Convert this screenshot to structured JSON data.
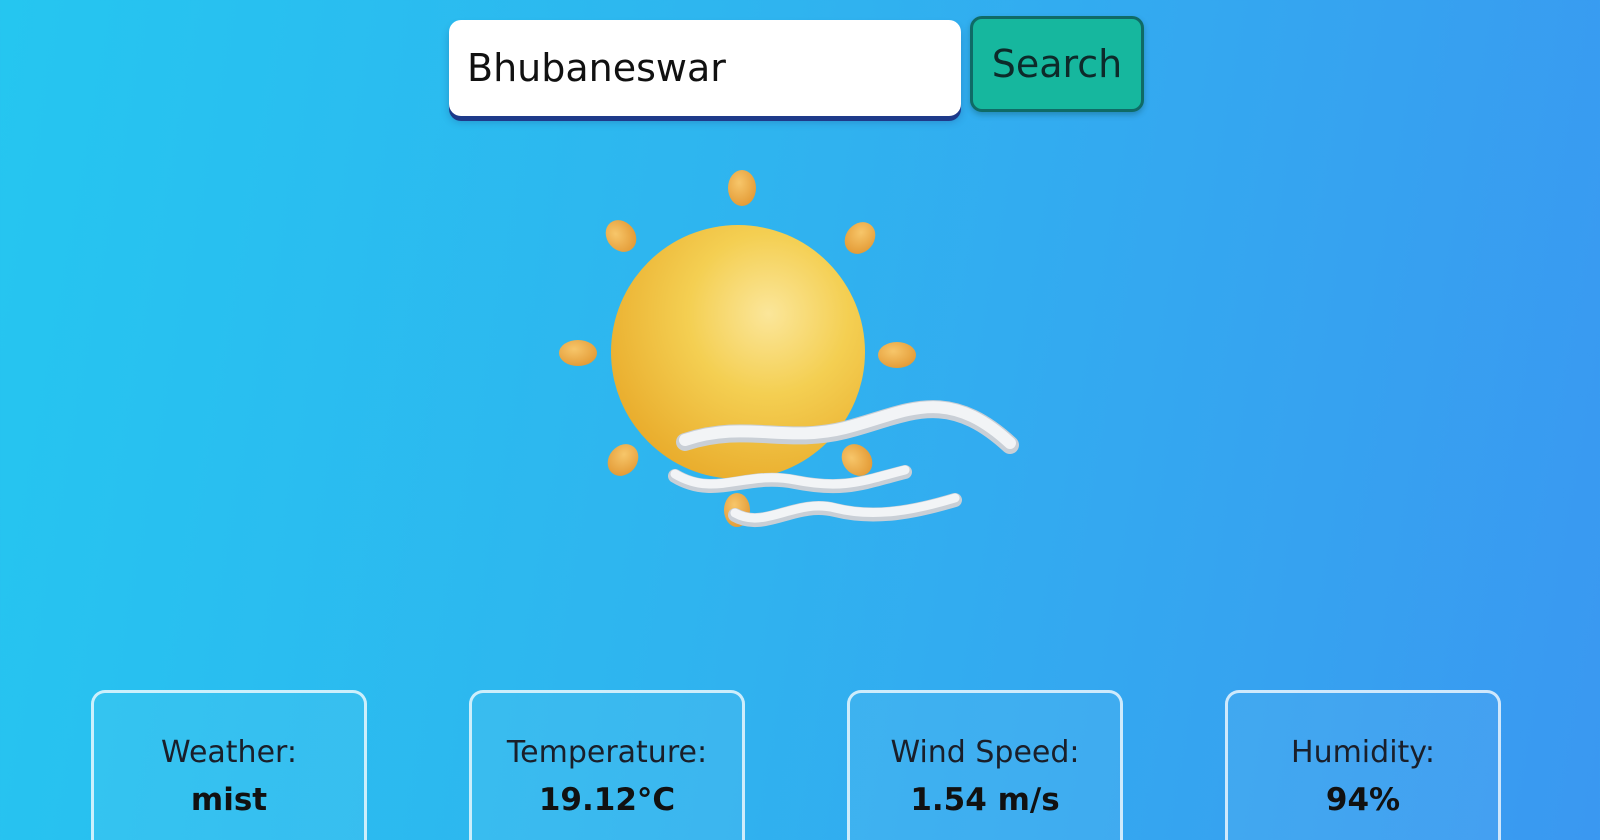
{
  "search": {
    "value": "Bhubaneswar",
    "button_label": "Search"
  },
  "weather_icon": {
    "name": "sun-with-wind-icon",
    "sun_color": "#f2c744",
    "ray_color": "#eba53f",
    "wind_color": "#e8ecef"
  },
  "cards": [
    {
      "label": "Weather:",
      "value": "mist"
    },
    {
      "label": "Temperature:",
      "value": "19.12°C"
    },
    {
      "label": "Wind Speed:",
      "value": "1.54 m/s"
    },
    {
      "label": "Humidity:",
      "value": "94%"
    }
  ],
  "colors": {
    "background_start": "#25c6f0",
    "background_end": "#3a98f1",
    "button_fill": "#16b79e",
    "input_underline": "#1e3a8a"
  }
}
